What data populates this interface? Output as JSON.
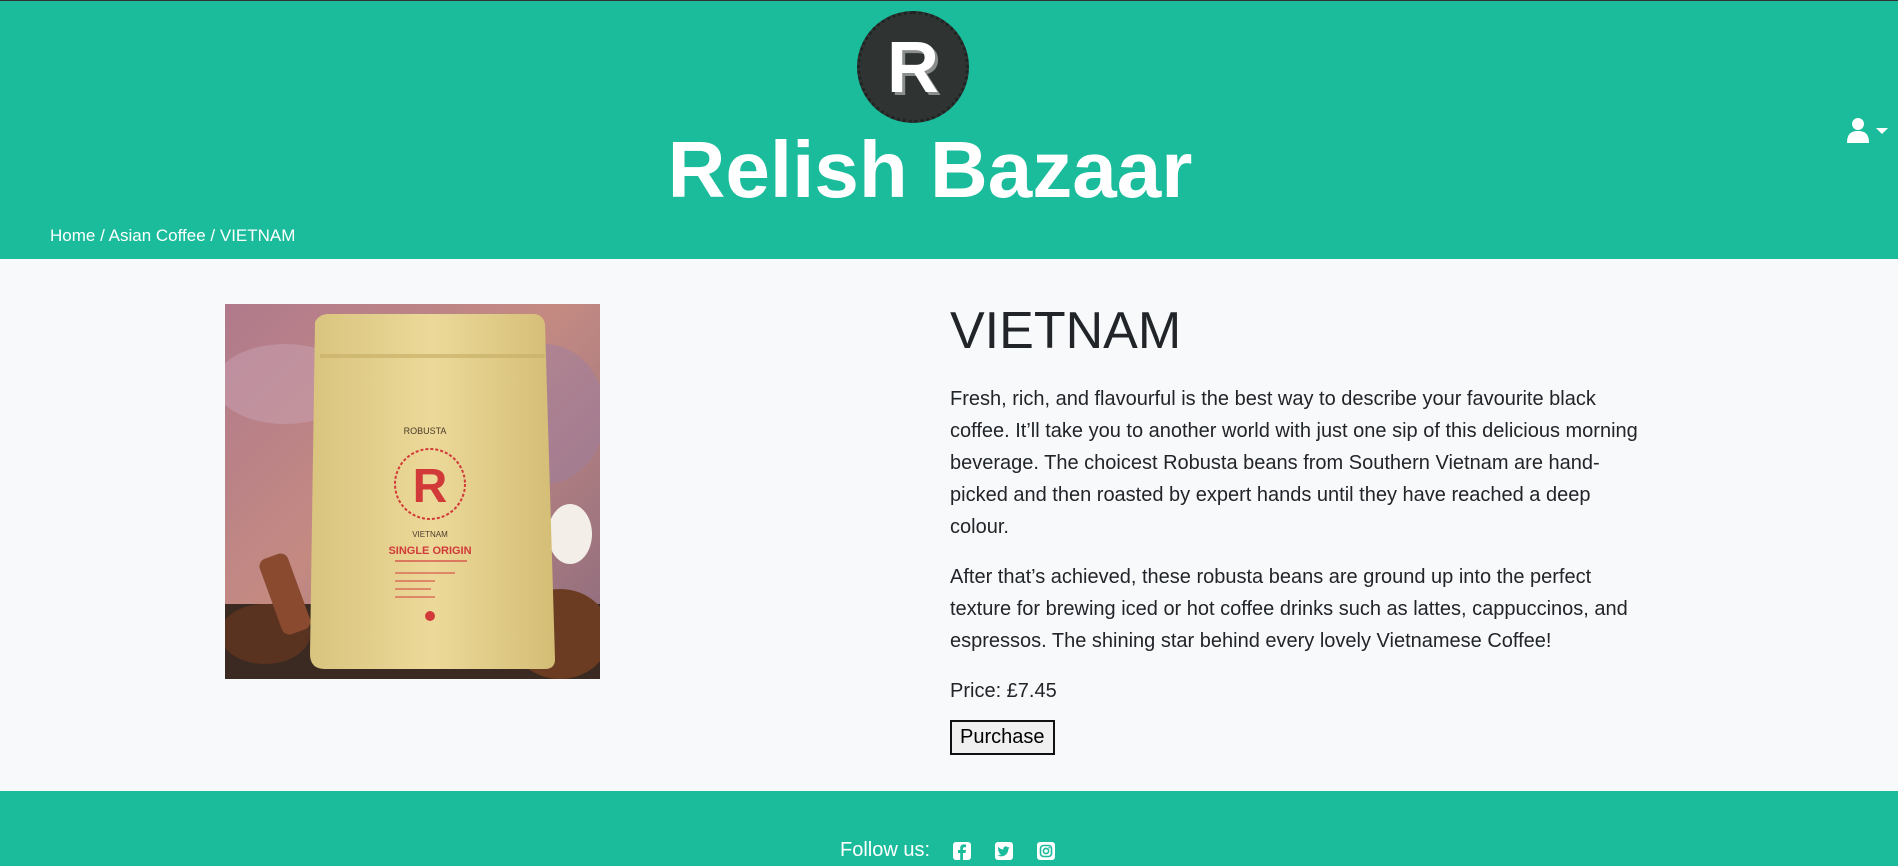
{
  "header": {
    "logo_letter": "R",
    "site_title": "Relish Bazaar",
    "user_menu_icon": "user-icon"
  },
  "breadcrumb": {
    "items": [
      "Home",
      "Asian Coffee",
      "VIETNAM"
    ],
    "separator": "/"
  },
  "product": {
    "image_labels": {
      "bean_type": "ROBUSTA",
      "brand_letter": "R",
      "origin": "VIETNAM",
      "tagline": "SINGLE ORIGIN"
    },
    "title": "VIETNAM",
    "description_1": "Fresh, rich, and flavourful is the best way to describe your favourite black coffee. It’ll take you to another world with just one sip of this delicious morning beverage. The choicest Robusta beans from Southern Vietnam are hand-picked and then roasted by expert hands until they have reached a deep colour.",
    "description_2": "After that’s achieved, these robusta beans are ground up into the perfect texture for brewing iced or hot coffee drinks such as lattes, cappuccinos, and espressos. The shining star behind every lovely Vietnamese Coffee!",
    "price": "Price: £7.45",
    "purchase_label": "Purchase"
  },
  "footer": {
    "follow_label": "Follow us:",
    "social_icons": [
      "facebook-icon",
      "twitter-icon",
      "instagram-icon"
    ]
  },
  "colors": {
    "brand_teal": "#1abc9c",
    "logo_dark": "#2f3433",
    "background": "#f8f9fa",
    "text": "#212529"
  }
}
